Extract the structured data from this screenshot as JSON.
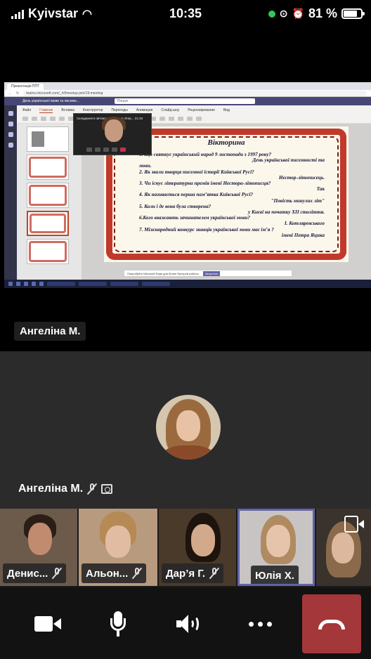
{
  "status_bar": {
    "carrier": "Kyivstar",
    "time": "10:35",
    "battery": "81 %",
    "battery_level": 0.81
  },
  "shared_screen": {
    "browser_tab": "Презентація ППТ",
    "url": "teams.microsoft.com/_#/l/meetup-join/19:meeting",
    "teams_title": "День української мови та писемн...",
    "teams_search": "Пошук",
    "ribbon_tabs": [
      "Файл",
      "Главная",
      "Вставка",
      "Конструктор",
      "Переходы",
      "Анимация",
      "Слайд-шоу",
      "Рецензирование",
      "Вид"
    ],
    "presenter_caption": "Складання в зв'язку: Зарубіжна літер...",
    "presenter_time": "21:34",
    "slide": {
      "title": "Вікторина",
      "lines": [
        {
          "text": "1. Що святкує український народ 9 листопада з 1997 року?",
          "align": "left"
        },
        {
          "text": "День української писемності та",
          "align": "right"
        },
        {
          "text": "мови.",
          "align": "left"
        },
        {
          "text": "2.  Як звали творця писемної історії Київської Русі?",
          "align": "left"
        },
        {
          "text": "Нестор-літописець.",
          "align": "right"
        },
        {
          "text": "3.  Чи існує літературна премія імені Нестора-літописця?",
          "align": "left"
        },
        {
          "text": "Так",
          "align": "right"
        },
        {
          "text": "4.  Як називається перша пам’ятка Київської Русі?",
          "align": "left"
        },
        {
          "text": "\"Повість минулих літ\"",
          "align": "right"
        },
        {
          "text": "5.  Коли і де вона була створена?",
          "align": "left"
        },
        {
          "text": "у Києві на початку XII століття.",
          "align": "right"
        },
        {
          "text": "6.Кого вважають зачинателем української мови?",
          "align": "left"
        },
        {
          "text": "І. Котляревського",
          "align": "right"
        },
        {
          "text": "7. Міжнародний конкурс знавців української мови має ім’я ?",
          "align": "left"
        },
        {
          "text": "імені Петра Яцика",
          "align": "right"
        }
      ]
    },
    "notice_text": "Попробуйте Microsoft Edge для более быстрой работы",
    "notice_button": "Запустить"
  },
  "presenter_label": "Ангеліна М.",
  "main_participant": {
    "name": "Ангеліна М."
  },
  "participants": [
    {
      "name": "Денис...",
      "muted": true
    },
    {
      "name": "Альон...",
      "muted": true
    },
    {
      "name": "Дар’я Г.",
      "muted": true
    },
    {
      "name": "Юлія Х.",
      "muted": false,
      "active": true
    },
    {
      "name": "",
      "muted": false
    }
  ],
  "controls": {
    "camera": "camera-icon",
    "mic": "microphone-icon",
    "speaker": "speaker-icon",
    "more": "more-icon",
    "hangup": "hang-up-icon"
  },
  "colors": {
    "hangup": "#a4373a",
    "teams_purple": "#6264a7",
    "slide_border": "#c0392b"
  }
}
